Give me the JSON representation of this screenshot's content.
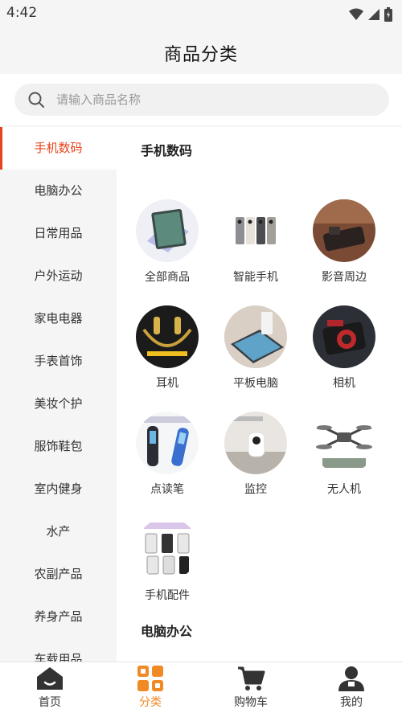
{
  "status": {
    "time": "4:42"
  },
  "header": {
    "title": "商品分类"
  },
  "search": {
    "placeholder": "请输入商品名称"
  },
  "sidebar": {
    "items": [
      {
        "label": "手机数码",
        "active": true
      },
      {
        "label": "电脑办公"
      },
      {
        "label": "日常用品"
      },
      {
        "label": "户外运动"
      },
      {
        "label": "家电电器"
      },
      {
        "label": "手表首饰"
      },
      {
        "label": "美妆个护"
      },
      {
        "label": "服饰鞋包"
      },
      {
        "label": "室内健身"
      },
      {
        "label": "水产"
      },
      {
        "label": "农副产品"
      },
      {
        "label": "养身产品"
      },
      {
        "label": "车载用品"
      }
    ]
  },
  "main": {
    "section1_title": "手机数码",
    "section2_title": "电脑办公",
    "categories": [
      {
        "label": "全部商品",
        "icon": "tablet-image"
      },
      {
        "label": "智能手机",
        "icon": "smartphone-image"
      },
      {
        "label": "影音周边",
        "icon": "media-accessory-image"
      },
      {
        "label": "耳机",
        "icon": "earphones-image"
      },
      {
        "label": "平板电脑",
        "icon": "tablet-pc-image"
      },
      {
        "label": "相机",
        "icon": "camera-image"
      },
      {
        "label": "点读笔",
        "icon": "reading-pen-image"
      },
      {
        "label": "监控",
        "icon": "security-camera-image"
      },
      {
        "label": "无人机",
        "icon": "drone-image"
      },
      {
        "label": "手机配件",
        "icon": "phone-accessories-image"
      }
    ]
  },
  "tabbar": {
    "tabs": [
      {
        "label": "首页",
        "icon": "home-icon"
      },
      {
        "label": "分类",
        "icon": "category-icon",
        "active": true
      },
      {
        "label": "购物车",
        "icon": "cart-icon"
      },
      {
        "label": "我的",
        "icon": "user-icon"
      }
    ]
  },
  "colors": {
    "accent": "#e8431c",
    "tab_active": "#f08a24"
  }
}
